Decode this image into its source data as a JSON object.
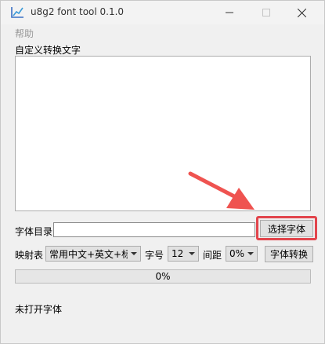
{
  "window": {
    "title": "u8g2 font tool 0.1.0"
  },
  "menu": {
    "help": "帮助"
  },
  "custom_text": {
    "label": "自定义转换文字",
    "value": ""
  },
  "font_dir": {
    "label": "字体目录",
    "value": "",
    "button": "选择字体"
  },
  "mapping": {
    "label": "映射表",
    "selected": "常用中文+英文+标",
    "size_label": "字号",
    "size_value": "12",
    "spacing_label": "间距",
    "spacing_value": "0%",
    "convert_button": "字体转换"
  },
  "progress": {
    "value": 0,
    "text": "0%"
  },
  "status": {
    "text": "未打开字体"
  },
  "colors": {
    "highlight": "#e2454c",
    "arrow": "#ef5350"
  }
}
